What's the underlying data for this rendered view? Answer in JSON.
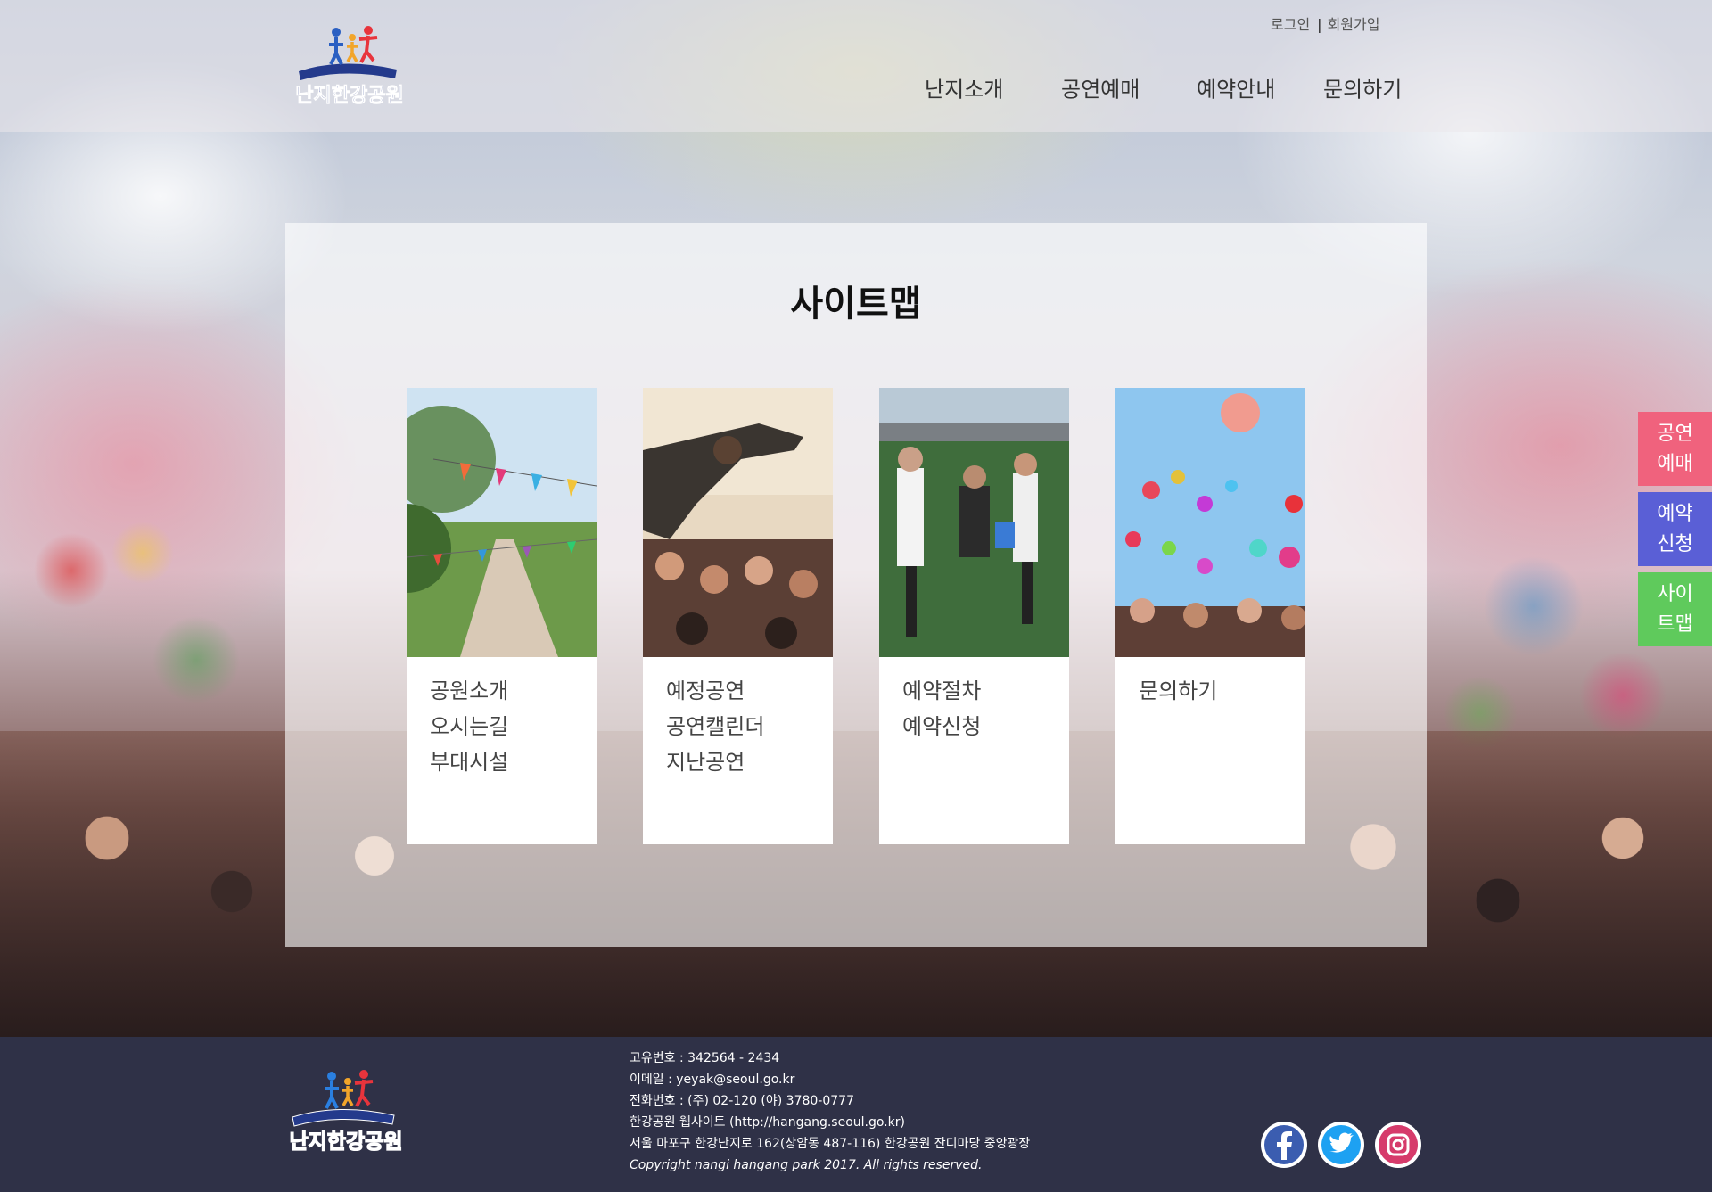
{
  "header": {
    "logo_text": "난지한강공원",
    "login": "로그인",
    "separator": "|",
    "signup": "회원가입",
    "nav": [
      "난지소개",
      "공연예매",
      "예약안내",
      "문의하기"
    ]
  },
  "sitemap": {
    "title": "사이트맵",
    "cards": [
      {
        "photo": "park-flags-photo",
        "links": [
          "공원소개",
          "오시는길",
          "부대시설"
        ]
      },
      {
        "photo": "concert-crowd-photo",
        "links": [
          "예정공연",
          "공연캘린더",
          "지난공연"
        ]
      },
      {
        "photo": "water-fight-photo",
        "links": [
          "예약절차",
          "예약신청"
        ]
      },
      {
        "photo": "balloons-photo",
        "links": [
          "문의하기"
        ]
      }
    ]
  },
  "side_buttons": [
    {
      "line1": "공연",
      "line2": "예매",
      "color": "#f0627d"
    },
    {
      "line1": "예약",
      "line2": "신청",
      "color": "#5a5fd6"
    },
    {
      "line1": "사이",
      "line2": "트맵",
      "color": "#5fca5c"
    }
  ],
  "footer": {
    "logo_text": "난지한강공원",
    "lines": [
      "고유번호 : 342564 - 2434",
      "이메일 : yeyak@seoul.go.kr",
      "전화번호 : (주) 02-120 (야) 3780-0777",
      "한강공원 웹사이트 (http://hangang.seoul.go.kr)",
      "서울 마포구 한강난지로 162(상암동 487-116) 한강공원 잔디마당 중앙광장"
    ],
    "copyright": "Copyright nangi hangang park 2017. All rights reserved.",
    "social": [
      "facebook-icon",
      "twitter-icon",
      "instagram-icon"
    ]
  },
  "colors": {
    "footer_bg": "#2f3147",
    "panel_bg": "rgba(255,255,255,0.62)"
  }
}
